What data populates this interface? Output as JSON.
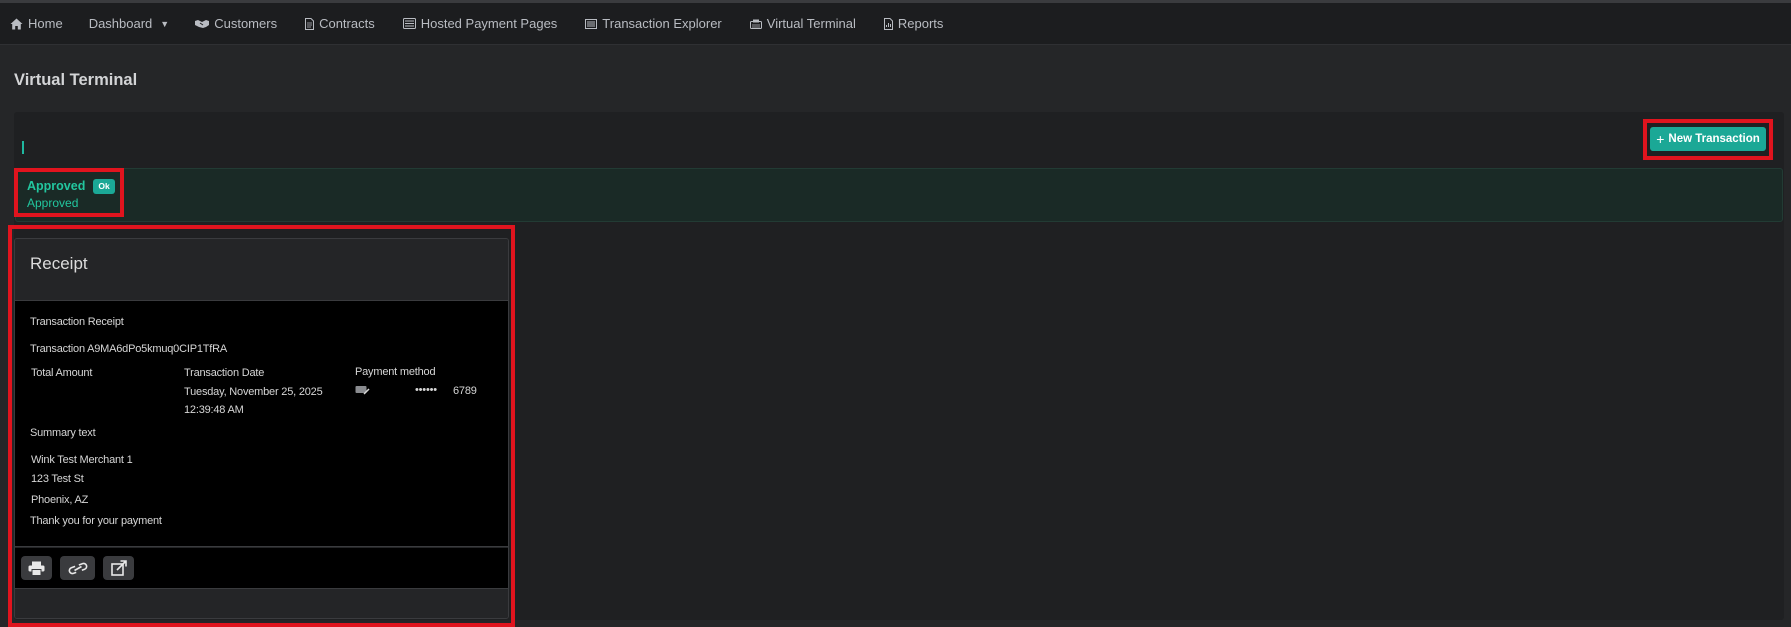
{
  "nav": {
    "items": [
      {
        "label": "Home",
        "icon": "home-icon"
      },
      {
        "label": "Dashboard",
        "icon": "chevron-down-icon"
      },
      {
        "label": "Customers",
        "icon": "handshake-icon"
      },
      {
        "label": "Contracts",
        "icon": "document-icon"
      },
      {
        "label": "Hosted Payment Pages",
        "icon": "pages-icon"
      },
      {
        "label": "Transaction Explorer",
        "icon": "list-icon"
      },
      {
        "label": "Virtual Terminal",
        "icon": "terminal-icon"
      },
      {
        "label": "Reports",
        "icon": "report-icon"
      }
    ]
  },
  "page": {
    "title": "Virtual Terminal"
  },
  "toolbar": {
    "new_transaction_label": "New Transaction"
  },
  "alert": {
    "title": "Approved",
    "badge": "Ok",
    "message": "Approved"
  },
  "receipt": {
    "title": "Receipt",
    "heading": "Transaction Receipt",
    "transaction_line": "Transaction A9MA6dPo5kmuq0CIP1TfRA",
    "total_amount_label": "Total Amount",
    "transaction_date_label": "Transaction Date",
    "transaction_date_value": "Tuesday, November 25, 2025",
    "transaction_time_value": "12:39:48 AM",
    "payment_method_label": "Payment method",
    "card_mask": "••••••",
    "card_last4": "6789",
    "summary_label": "Summary text",
    "merchant_name": "Wink Test Merchant 1",
    "merchant_street": "123 Test St",
    "merchant_city": "Phoenix, AZ",
    "thank_you": "Thank you for your payment",
    "actions": [
      "print-icon",
      "link-icon",
      "external-link-icon"
    ]
  },
  "colors": {
    "accent": "#1ba896",
    "success_text": "#22c79f",
    "highlight": "#e0141e",
    "background": "#252628"
  }
}
